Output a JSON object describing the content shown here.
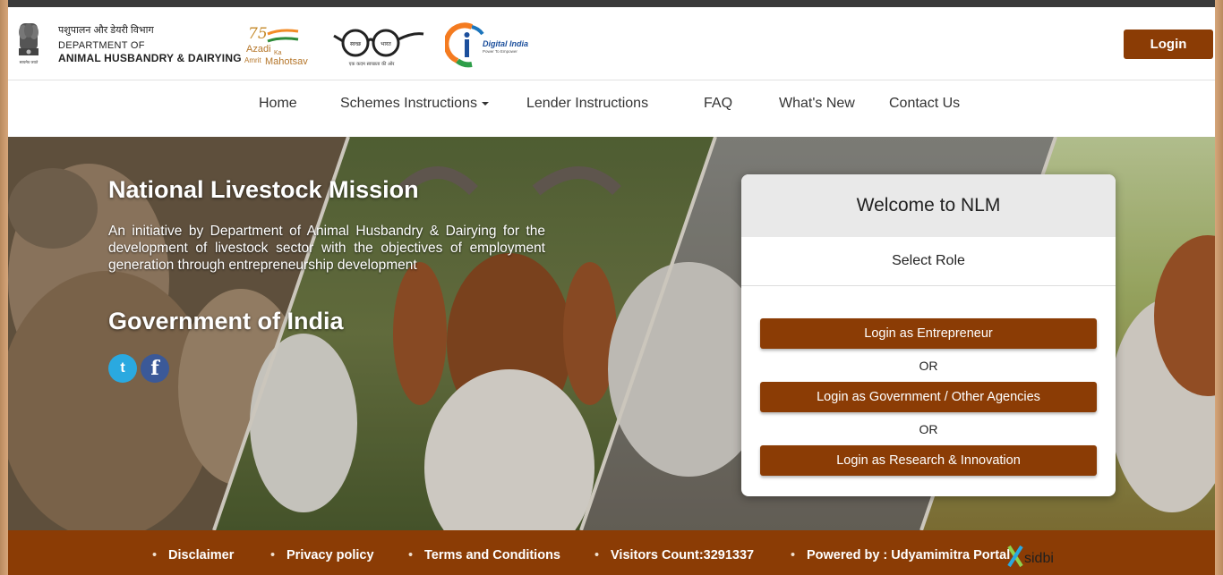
{
  "header": {
    "dept_hindi": "पशुपालन और डेयरी विभाग",
    "dept_line1": "DEPARTMENT OF",
    "dept_line2": "ANIMAL HUSBANDRY & DAIRYING",
    "emblem_caption": "सत्यमेव जयते",
    "azadi_75": "75",
    "azadi_line1": "Azadi",
    "azadi_ka": "Ka",
    "azadi_line2": "Amrit",
    "azadi_line3": "Mahotsav",
    "swachh_left": "स्वच्छ",
    "swachh_right": "भारत",
    "swachh_tagline": "एक कदम स्वच्छता की ओर",
    "digital_india": "Digital India",
    "digital_india_tag": "Power To Empower",
    "login_label": "Login"
  },
  "nav": {
    "items": [
      "Home",
      "Schemes Instructions",
      "Lender Instructions",
      "FAQ",
      "What's New",
      "Contact Us"
    ]
  },
  "hero": {
    "title": "National Livestock Mission",
    "description": "An initiative by Department of Animal Husbandry & Dairying for the development of livestock sector with the objectives of employment generation through entrepreneurship development",
    "gov": "Government of India",
    "twitter_glyph": "t",
    "facebook_glyph": "f"
  },
  "card": {
    "title": "Welcome to NLM",
    "subtitle": "Select Role",
    "btn_entrepreneur": "Login as Entrepreneur",
    "or": "OR",
    "btn_government": "Login as Government / Other Agencies",
    "btn_research": "Login as Research & Innovation"
  },
  "footer": {
    "disclaimer": "Disclaimer",
    "privacy": "Privacy policy",
    "terms": "Terms and Conditions",
    "visitors": "Visitors Count:3291337",
    "powered": "Powered by : Udyamimitra Portal",
    "sidbi": "sidbi"
  },
  "colors": {
    "brand_brown": "#8b3c05",
    "twitter_blue": "#2aa9e0",
    "facebook_blue": "#3b5998"
  }
}
